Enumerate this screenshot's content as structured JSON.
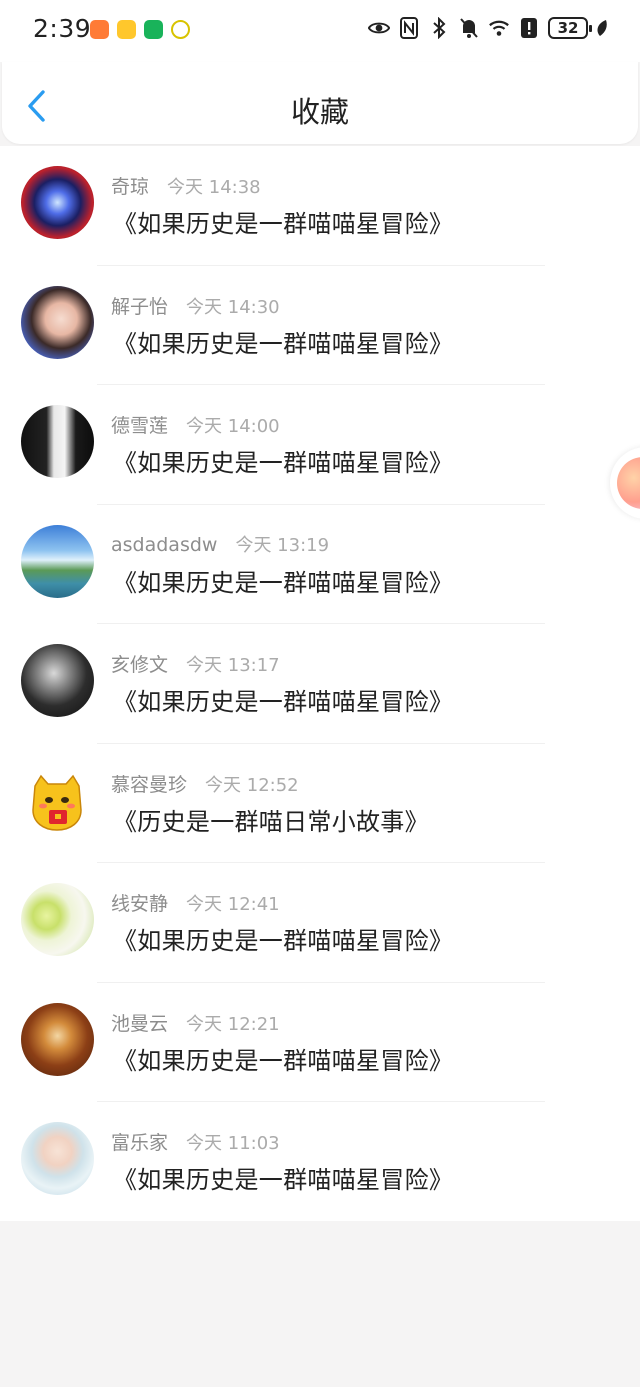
{
  "status_bar": {
    "time": "2:39",
    "battery": "32"
  },
  "header": {
    "title": "收藏"
  },
  "favorites": [
    {
      "name": "奇琼",
      "time": "今天 14:38",
      "title": "《如果历史是一群喵喵星冒险》"
    },
    {
      "name": "解子怡",
      "time": "今天 14:30",
      "title": "《如果历史是一群喵喵星冒险》"
    },
    {
      "name": "德雪莲",
      "time": "今天 14:00",
      "title": "《如果历史是一群喵喵星冒险》"
    },
    {
      "name": "asdadasdw",
      "time": "今天 13:19",
      "title": "《如果历史是一群喵喵星冒险》"
    },
    {
      "name": "亥修文",
      "time": "今天 13:17",
      "title": "《如果历史是一群喵喵星冒险》"
    },
    {
      "name": "慕容曼珍",
      "time": "今天 12:52",
      "title": "《历史是一群喵日常小故事》"
    },
    {
      "name": "线安静",
      "time": "今天 12:41",
      "title": "《如果历史是一群喵喵星冒险》"
    },
    {
      "name": "池曼云",
      "time": "今天 12:21",
      "title": "《如果历史是一群喵喵星冒险》"
    },
    {
      "name": "富乐家",
      "time": "今天 11:03",
      "title": "《如果历史是一群喵喵星冒险》"
    }
  ],
  "colors": {
    "accent": "#2a9cf0",
    "text": "#222222",
    "meta": "#8d8d8d"
  }
}
